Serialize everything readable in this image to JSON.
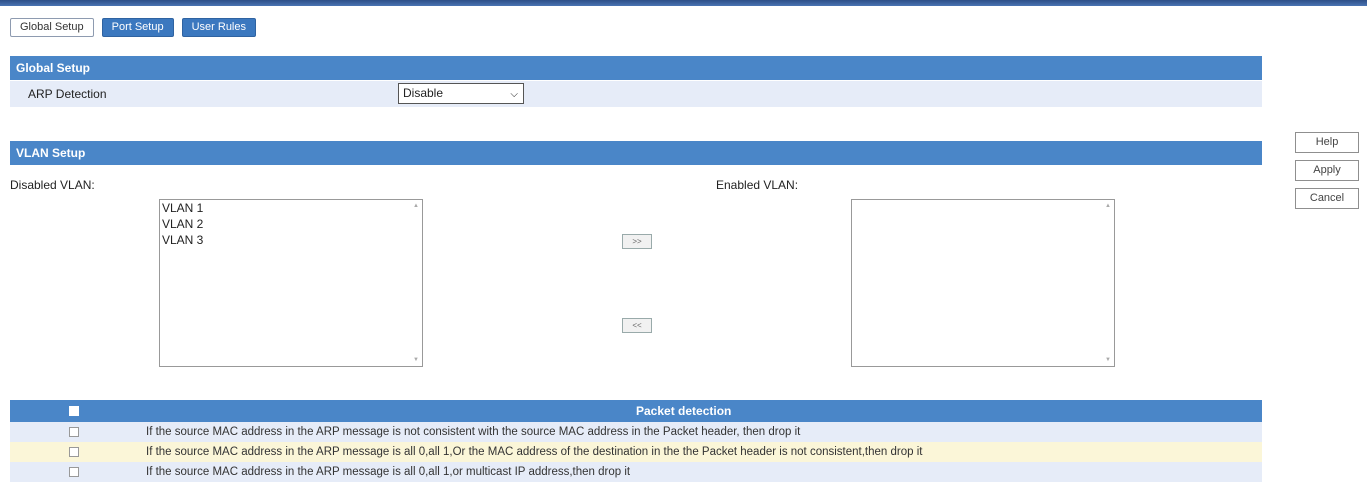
{
  "tabs": [
    {
      "label": "Global Setup",
      "active": true
    },
    {
      "label": "Port Setup",
      "active": false
    },
    {
      "label": "User Rules",
      "active": false
    }
  ],
  "global_setup": {
    "header": "Global Setup",
    "arp_label": "ARP Detection",
    "arp_value": "Disable"
  },
  "vlan_setup": {
    "header": "VLAN Setup",
    "disabled_label": "Disabled VLAN:",
    "enabled_label": "Enabled VLAN:",
    "disabled_items": [
      "VLAN 1",
      "VLAN 2",
      "VLAN 3"
    ],
    "enabled_items": [],
    "move_right": ">>",
    "move_left": "<<"
  },
  "side_buttons": {
    "help": "Help",
    "apply": "Apply",
    "cancel": "Cancel"
  },
  "packet_detection": {
    "header": "Packet detection",
    "rows": [
      "If the source MAC address in the ARP message is not consistent with the source MAC address in the Packet header, then drop it",
      "If the source MAC address in the ARP message is all 0,all 1,Or the MAC address of the destination in the the Packet header is not consistent,then drop it",
      "If the source MAC address in the ARP message is all 0,all 1,or multicast IP address,then drop it"
    ]
  },
  "colors": {
    "header_blue": "#4a86c8",
    "row_light_blue": "#e6ecf8",
    "row_light_yellow": "#fbf6d8"
  }
}
